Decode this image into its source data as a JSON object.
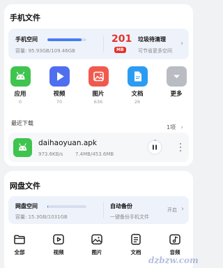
{
  "phone": {
    "title": "手机文件",
    "storage": {
      "label": "手机空间",
      "capacity": "容量: 95.93GB/109.46GB",
      "used_fraction": 0.876
    },
    "junk": {
      "value": "201",
      "unit": "MB",
      "label": "垃圾待清理",
      "sub": "可节省更多空间"
    },
    "categories": [
      {
        "label": "应用",
        "count": "0",
        "color": "#3ec44f"
      },
      {
        "label": "视频",
        "count": "70",
        "color": "#4f6ff0"
      },
      {
        "label": "图片",
        "count": "636",
        "color": "#f05a4e"
      },
      {
        "label": "文档",
        "count": "26",
        "color": "#2c9cf2"
      },
      {
        "label": "更多",
        "count": "",
        "color": "#b9bcc2"
      }
    ],
    "recent": {
      "title": "最近下载",
      "count": "1项",
      "file": {
        "name": "daihaoyuan.apk",
        "speed": "973.6KB/s",
        "size": "7.4MB/453.6MB",
        "progress_fraction": 0.016
      }
    }
  },
  "cloud": {
    "title": "网盘文件",
    "storage": {
      "label": "网盘空间",
      "capacity": "容量: 15.3GB/1031GB",
      "used_fraction": 0.015
    },
    "backup": {
      "label": "自动备份",
      "sub": "一键备份手机文件",
      "status": "开启"
    }
  },
  "bottom_nav": [
    {
      "label": "全部"
    },
    {
      "label": "视频"
    },
    {
      "label": "图片"
    },
    {
      "label": "文档"
    },
    {
      "label": "音频"
    }
  ],
  "watermark": "dzbzw.com",
  "colors": {
    "accent": "#4a7cf0",
    "junk_red": "#e5322d",
    "storage_bg": "#eef3fb"
  }
}
